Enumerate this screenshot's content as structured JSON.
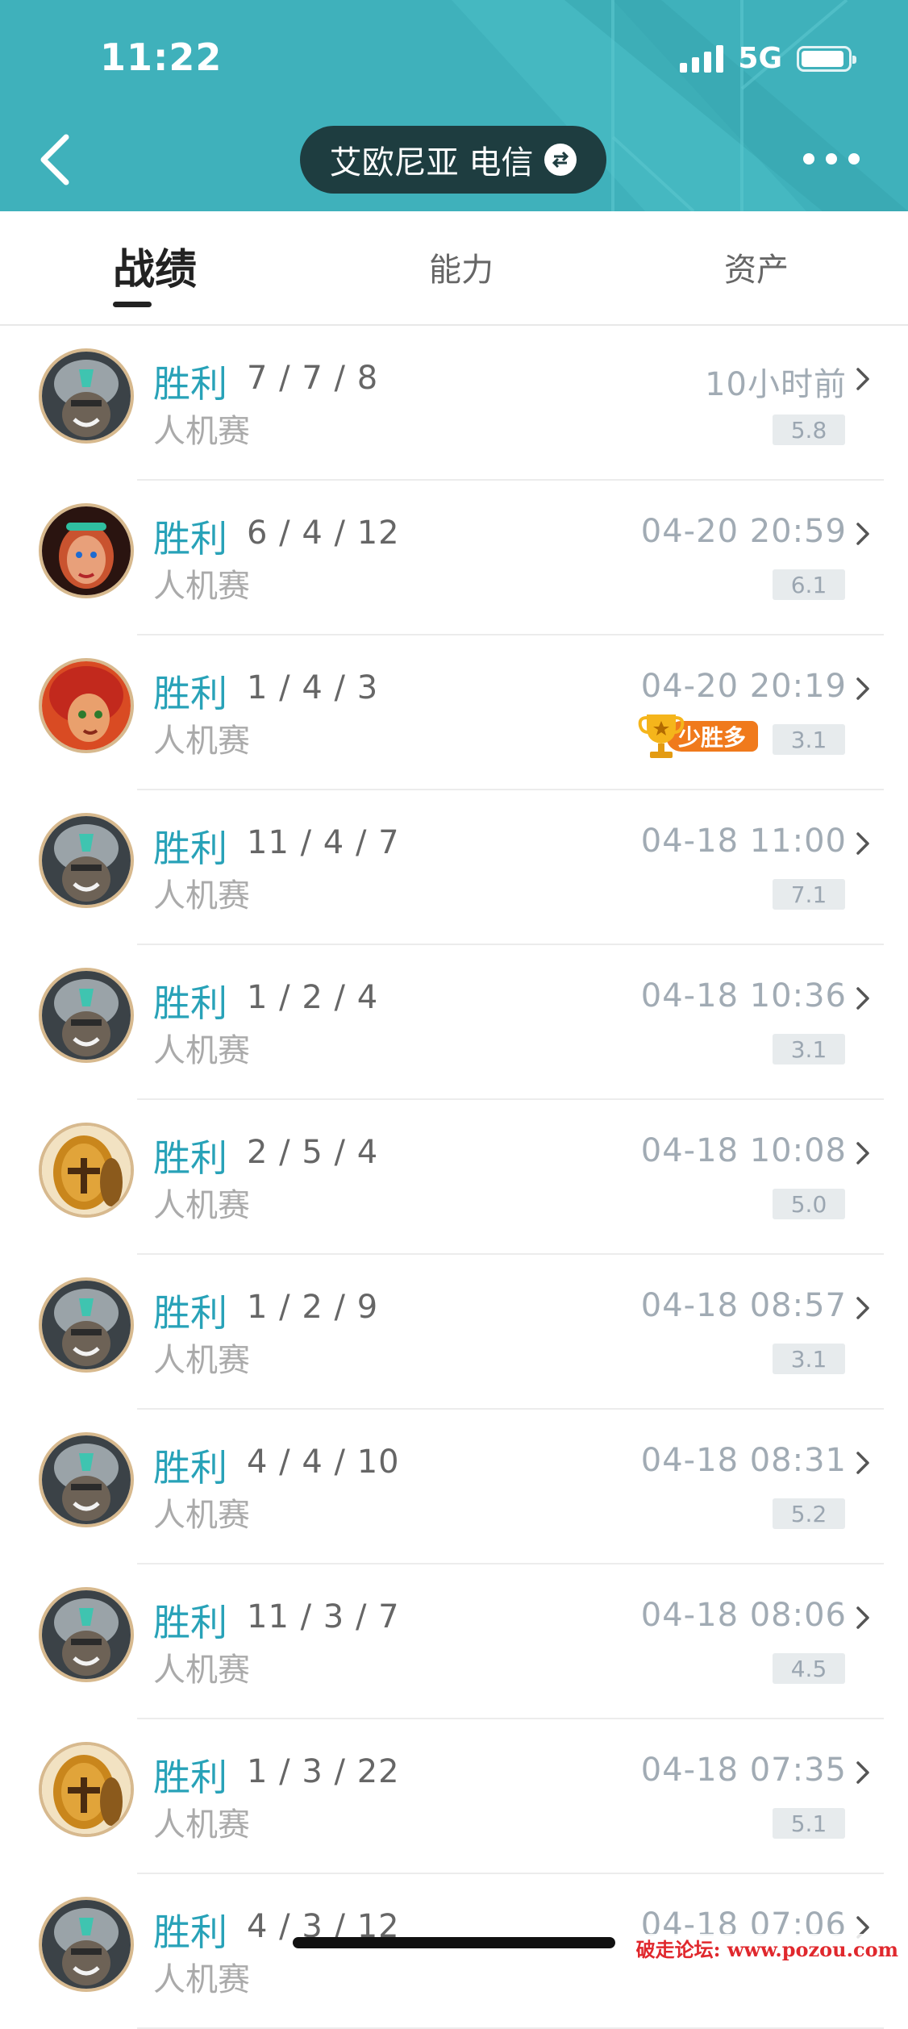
{
  "status_bar": {
    "time": "11:22",
    "network": "5G"
  },
  "header": {
    "server_name": "艾欧尼亚 电信",
    "back_icon": "chevron-left-icon",
    "switch_icon": "swap-icon",
    "more_icon": "more-dots-icon",
    "accent_color": "#3fb1bb"
  },
  "tabs": [
    {
      "label": "战绩",
      "active": true
    },
    {
      "label": "能力",
      "active": false
    },
    {
      "label": "资产",
      "active": false
    }
  ],
  "matches": [
    {
      "result": "胜利",
      "kda": "7 / 7 / 8",
      "mode": "人机赛",
      "time": "10小时前",
      "score": "5.8",
      "champion": "helmet-warrior"
    },
    {
      "result": "胜利",
      "kda": "6 / 4 / 12",
      "mode": "人机赛",
      "time": "04-20 20:59",
      "score": "6.1",
      "champion": "red-hair-woman"
    },
    {
      "result": "胜利",
      "kda": "1 / 4 / 3",
      "mode": "人机赛",
      "time": "04-20 20:19",
      "score": "3.1",
      "champion": "red-hair-girl",
      "award": "少胜多"
    },
    {
      "result": "胜利",
      "kda": "11 / 4 / 7",
      "mode": "人机赛",
      "time": "04-18 11:00",
      "score": "7.1",
      "champion": "helmet-warrior"
    },
    {
      "result": "胜利",
      "kda": "1 / 2 / 4",
      "mode": "人机赛",
      "time": "04-18 10:36",
      "score": "3.1",
      "champion": "helmet-warrior"
    },
    {
      "result": "胜利",
      "kda": "2 / 5 / 4",
      "mode": "人机赛",
      "time": "04-18 10:08",
      "score": "5.0",
      "champion": "golden-helmet"
    },
    {
      "result": "胜利",
      "kda": "1 / 2 / 9",
      "mode": "人机赛",
      "time": "04-18 08:57",
      "score": "3.1",
      "champion": "helmet-warrior"
    },
    {
      "result": "胜利",
      "kda": "4 / 4 / 10",
      "mode": "人机赛",
      "time": "04-18 08:31",
      "score": "5.2",
      "champion": "helmet-warrior"
    },
    {
      "result": "胜利",
      "kda": "11 / 3 / 7",
      "mode": "人机赛",
      "time": "04-18 08:06",
      "score": "4.5",
      "champion": "helmet-warrior"
    },
    {
      "result": "胜利",
      "kda": "1 / 3 / 22",
      "mode": "人机赛",
      "time": "04-18 07:35",
      "score": "5.1",
      "champion": "golden-helmet"
    },
    {
      "result": "胜利",
      "kda": "4 / 3 / 12",
      "mode": "人机赛",
      "time": "04-18 07:06",
      "score": "",
      "champion": "helmet-warrior"
    }
  ],
  "watermark": "破走论坛: www.pozou.com"
}
